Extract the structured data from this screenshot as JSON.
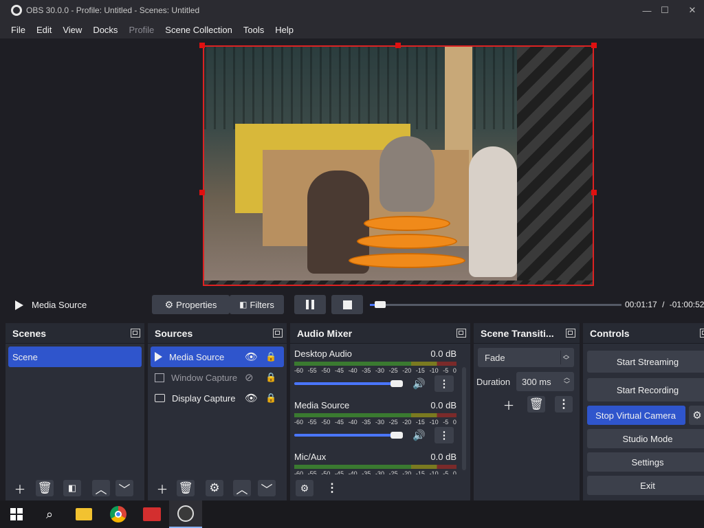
{
  "window": {
    "title": "OBS 30.0.0 - Profile: Untitled - Scenes: Untitled",
    "minimize": "—",
    "maximize": "☐",
    "close": "✕"
  },
  "menu": [
    "File",
    "Edit",
    "View",
    "Docks",
    "Profile",
    "Scene Collection",
    "Tools",
    "Help"
  ],
  "media_controls": {
    "source_name": "Media Source",
    "properties_label": "Properties",
    "filters_label": "Filters",
    "elapsed": "00:01:17",
    "separator": "/",
    "remaining": "-01:00:52",
    "progress_fraction": 0.03
  },
  "scenes_dock": {
    "title": "Scenes",
    "items": [
      "Scene"
    ]
  },
  "sources_dock": {
    "title": "Sources",
    "items": [
      {
        "name": "Media Source",
        "icon": "play-icon",
        "visible": true,
        "selected": true
      },
      {
        "name": "Window Capture",
        "icon": "window-icon",
        "visible": false,
        "selected": false
      },
      {
        "name": "Display Capture",
        "icon": "monitor-icon",
        "visible": true,
        "selected": false
      }
    ]
  },
  "audio_mixer": {
    "title": "Audio Mixer",
    "scale": [
      "-60",
      "-55",
      "-50",
      "-45",
      "-40",
      "-35",
      "-30",
      "-25",
      "-20",
      "-15",
      "-10",
      "-5",
      "0"
    ],
    "channels": [
      {
        "name": "Desktop Audio",
        "db": "0.0 dB",
        "volume": 1.0
      },
      {
        "name": "Media Source",
        "db": "0.0 dB",
        "volume": 1.0
      },
      {
        "name": "Mic/Aux",
        "db": "0.0 dB",
        "volume": 1.0
      }
    ]
  },
  "transitions": {
    "title": "Scene Transiti...",
    "selected": "Fade",
    "duration_label": "Duration",
    "duration_value": "300 ms"
  },
  "controls": {
    "title": "Controls",
    "start_streaming": "Start Streaming",
    "start_recording": "Start Recording",
    "stop_virtual_camera": "Stop Virtual Camera",
    "studio_mode": "Studio Mode",
    "settings": "Settings",
    "exit": "Exit"
  },
  "colors": {
    "accent": "#2f55cc",
    "selection_border": "#dd2222",
    "panel": "#2b2e38",
    "background": "#1e1e24"
  }
}
